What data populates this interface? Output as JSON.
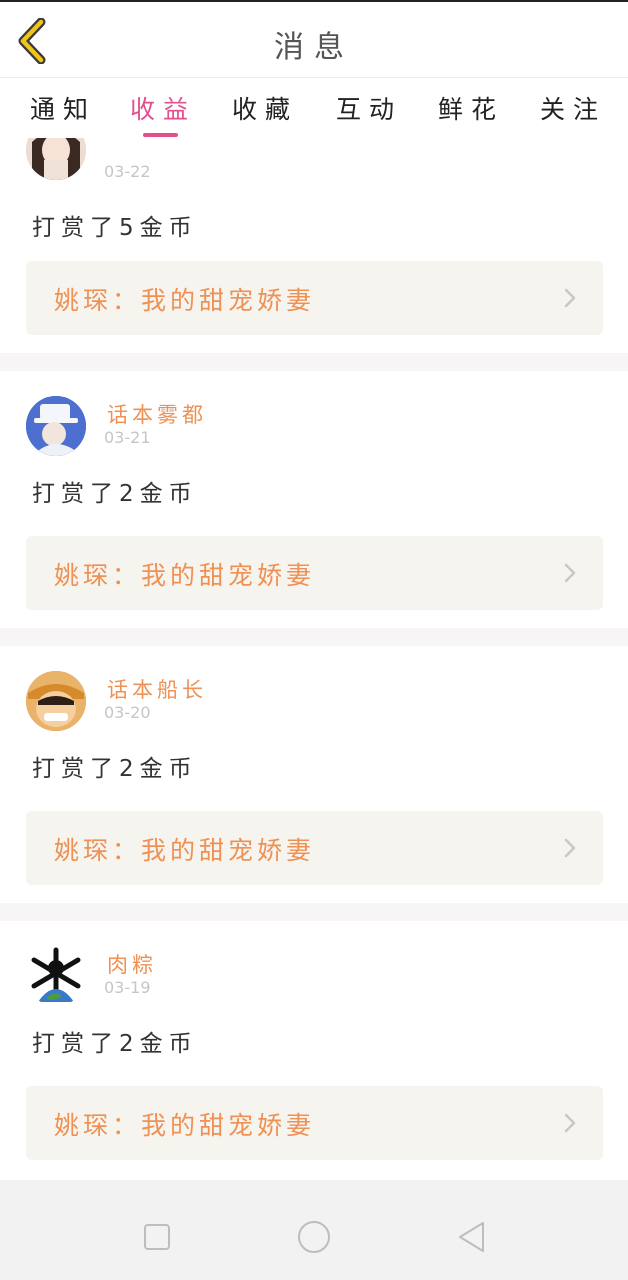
{
  "header": {
    "title": "消息"
  },
  "tabs": [
    {
      "label": "通知",
      "active": false
    },
    {
      "label": "收益",
      "active": true
    },
    {
      "label": "收藏",
      "active": false
    },
    {
      "label": "互动",
      "active": false
    },
    {
      "label": "鲜花",
      "active": false
    },
    {
      "label": "关注",
      "active": false
    }
  ],
  "colors": {
    "accent": "#e14f8e",
    "username": "#ef9155",
    "book_bg": "#f5f4ee",
    "date": "#c6c6c6"
  },
  "items": [
    {
      "user": "",
      "date": "03-22",
      "reward": "打赏了5金币",
      "book": "姚琛：我的甜宠娇妻"
    },
    {
      "user": "话本雾都",
      "date": "03-21",
      "reward": "打赏了2金币",
      "book": "姚琛：我的甜宠娇妻"
    },
    {
      "user": "话本船长",
      "date": "03-20",
      "reward": "打赏了2金币",
      "book": "姚琛：我的甜宠娇妻"
    },
    {
      "user": "肉粽",
      "date": "03-19",
      "reward": "打赏了2金币",
      "book": "姚琛：我的甜宠娇妻"
    }
  ],
  "navbar": {
    "icons": [
      "recent-apps-icon",
      "home-icon",
      "back-triangle-icon"
    ]
  }
}
